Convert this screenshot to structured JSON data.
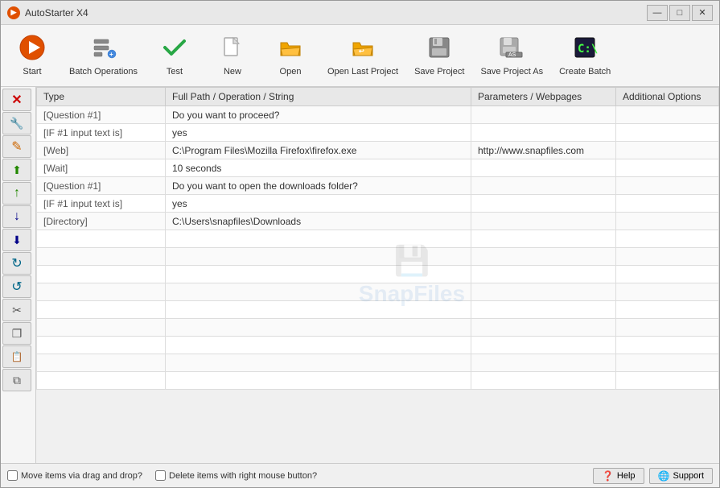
{
  "window": {
    "title": "AutoStarter X4",
    "title_icon": "▶",
    "controls": {
      "minimize": "—",
      "maximize": "□",
      "close": "✕"
    }
  },
  "toolbar": {
    "buttons": [
      {
        "id": "start",
        "label": "Start",
        "icon": "start"
      },
      {
        "id": "batch-operations",
        "label": "Batch Operations",
        "icon": "batch"
      },
      {
        "id": "test",
        "label": "Test",
        "icon": "test"
      },
      {
        "id": "new",
        "label": "New",
        "icon": "new"
      },
      {
        "id": "open",
        "label": "Open",
        "icon": "open"
      },
      {
        "id": "open-last-project",
        "label": "Open Last Project",
        "icon": "open-last"
      },
      {
        "id": "save-project",
        "label": "Save Project",
        "icon": "save"
      },
      {
        "id": "save-project-as",
        "label": "Save Project As",
        "icon": "save-as"
      },
      {
        "id": "create-batch",
        "label": "Create Batch",
        "icon": "create-batch"
      }
    ]
  },
  "side_toolbar": {
    "buttons": [
      {
        "id": "delete",
        "label": "✕",
        "color": "red"
      },
      {
        "id": "edit",
        "label": "✎",
        "color": "orange"
      },
      {
        "id": "pencil",
        "label": "✏",
        "color": "orange"
      },
      {
        "id": "move-up-top",
        "label": "⬆",
        "color": "green"
      },
      {
        "id": "move-up",
        "label": "↑",
        "color": "green"
      },
      {
        "id": "move-down",
        "label": "↓",
        "color": "darkblue"
      },
      {
        "id": "move-down-bottom",
        "label": "⬇",
        "color": "darkblue"
      },
      {
        "id": "rotate-cw",
        "label": "↻",
        "color": "teal"
      },
      {
        "id": "rotate-ccw",
        "label": "↺",
        "color": "teal"
      },
      {
        "id": "scissors",
        "label": "✂",
        "color": "gray"
      },
      {
        "id": "copy",
        "label": "❐",
        "color": "gray"
      },
      {
        "id": "paste",
        "label": "📋",
        "color": "gray"
      },
      {
        "id": "clone",
        "label": "⧉",
        "color": "gray"
      }
    ]
  },
  "table": {
    "columns": [
      {
        "id": "type",
        "label": "Type"
      },
      {
        "id": "path",
        "label": "Full Path / Operation / String"
      },
      {
        "id": "params",
        "label": "Parameters / Webpages"
      },
      {
        "id": "options",
        "label": "Additional Options"
      }
    ],
    "rows": [
      {
        "type": "[Question #1]",
        "path": "Do you want to proceed?",
        "params": "",
        "options": ""
      },
      {
        "type": "[IF #1 input text is]",
        "path": "yes",
        "params": "",
        "options": ""
      },
      {
        "type": "[Web]",
        "path": "C:\\Program Files\\Mozilla Firefox\\firefox.exe",
        "params": "http://www.snapfiles.com",
        "options": ""
      },
      {
        "type": "[Wait]",
        "path": "10 seconds",
        "params": "",
        "options": ""
      },
      {
        "type": "[Question #1]",
        "path": "Do you want to open the downloads folder?",
        "params": "",
        "options": ""
      },
      {
        "type": "[IF #1 input text is]",
        "path": "yes",
        "params": "",
        "options": ""
      },
      {
        "type": "[Directory]",
        "path": "C:\\Users\\snapfiles\\Downloads",
        "params": "",
        "options": ""
      },
      {
        "type": "",
        "path": "",
        "params": "",
        "options": ""
      },
      {
        "type": "",
        "path": "",
        "params": "",
        "options": ""
      },
      {
        "type": "",
        "path": "",
        "params": "",
        "options": ""
      },
      {
        "type": "",
        "path": "",
        "params": "",
        "options": ""
      },
      {
        "type": "",
        "path": "",
        "params": "",
        "options": ""
      },
      {
        "type": "",
        "path": "",
        "params": "",
        "options": ""
      },
      {
        "type": "",
        "path": "",
        "params": "",
        "options": ""
      },
      {
        "type": "",
        "path": "",
        "params": "",
        "options": ""
      },
      {
        "type": "",
        "path": "",
        "params": "",
        "options": ""
      }
    ]
  },
  "watermark": {
    "icon": "💾",
    "text": "SnapFiles"
  },
  "status_bar": {
    "checkbox1_label": "Move items via drag and drop?",
    "checkbox2_label": "Delete items with right mouse button?",
    "help_label": "Help",
    "support_label": "Support"
  }
}
